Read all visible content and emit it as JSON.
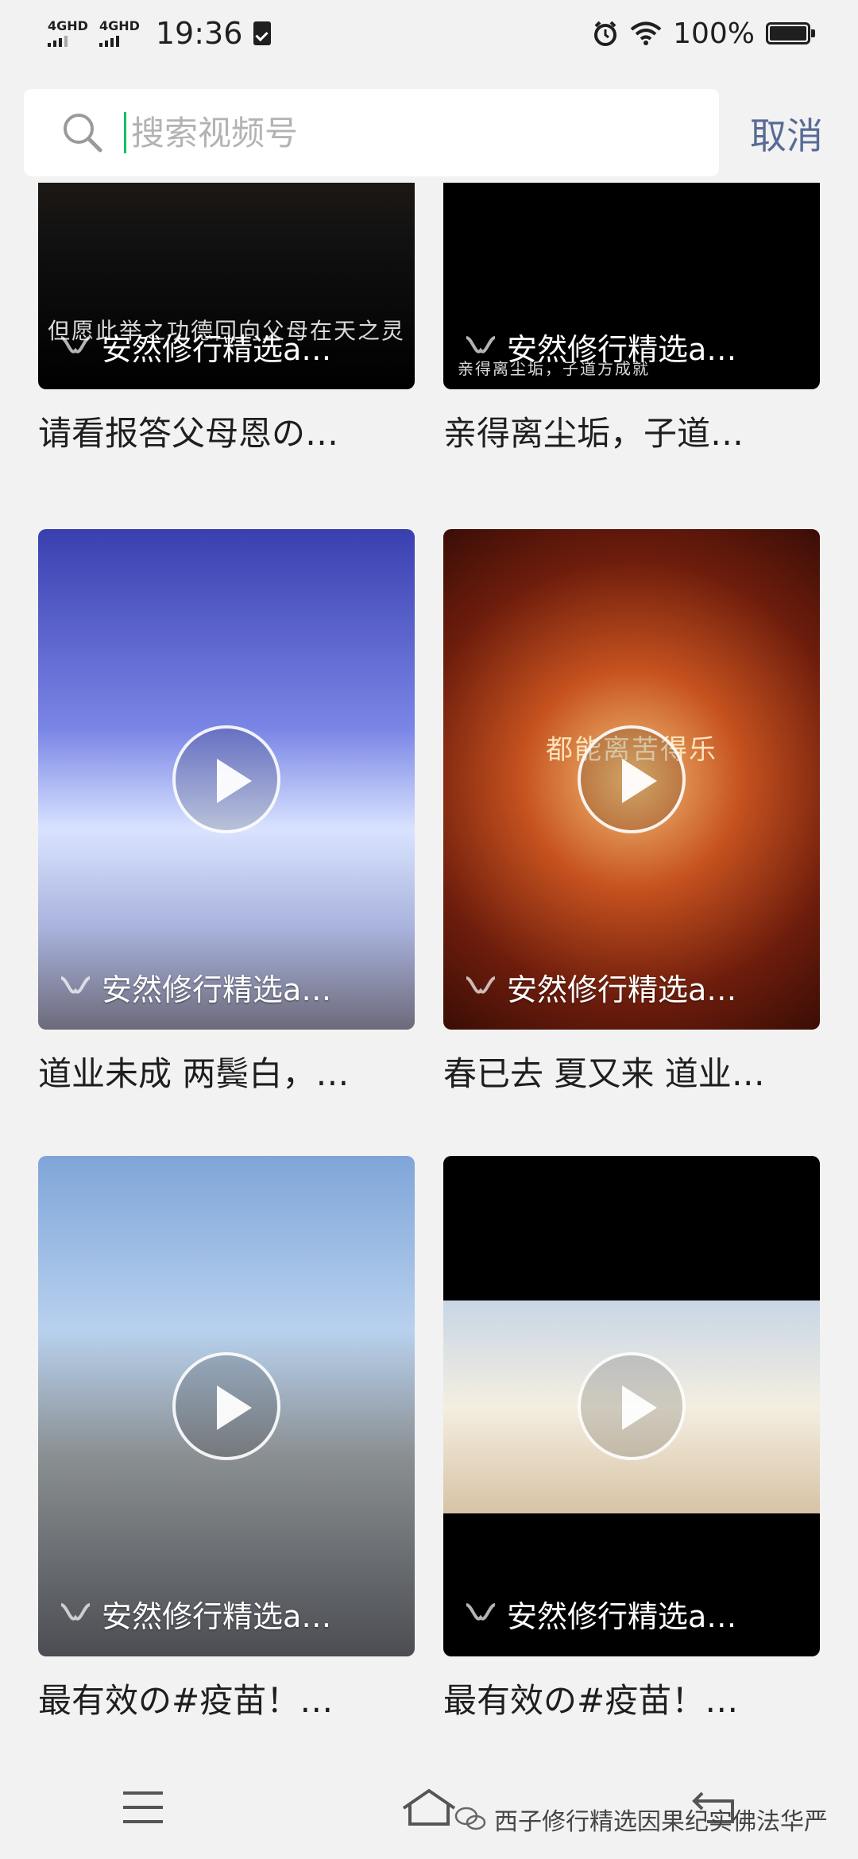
{
  "status_bar": {
    "network_1": "4GHD",
    "network_2": "4GHD",
    "time": "19:36",
    "battery": "100%"
  },
  "search": {
    "placeholder": "搜索视频号",
    "value": "",
    "cancel_label": "取消"
  },
  "videos": [
    {
      "author": "安然修行精选a…",
      "caption": "请看报答父母恩の…",
      "overlay": "但愿此举之功德回向父母在天之灵"
    },
    {
      "author": "安然修行精选a…",
      "caption": "亲得离尘垢，子道…",
      "overlay": "亲得离尘垢，子道方成就"
    },
    {
      "author": "安然修行精选a…",
      "caption": "道业未成 两鬓白，…",
      "overlay": ""
    },
    {
      "author": "安然修行精选a…",
      "caption": "春已去 夏又来 道业…",
      "overlay": "都能离苦得乐"
    },
    {
      "author": "安然修行精选a…",
      "caption": "最有效の#疫苗！…",
      "overlay": ""
    },
    {
      "author": "安然修行精选a…",
      "caption": "最有效の#疫苗！…",
      "overlay": ""
    }
  ],
  "watermark": {
    "text": "西子修行精选因果纪实佛法华严"
  },
  "colors": {
    "accent_green": "#07c160",
    "cancel_blue": "#576b95",
    "background": "#f2f2f2"
  },
  "icons": [
    "alarm-icon",
    "wifi-icon",
    "battery-icon",
    "search-icon",
    "play-icon",
    "channels-logo-icon",
    "menu-icon",
    "home-icon",
    "back-icon",
    "wechat-icon"
  ]
}
